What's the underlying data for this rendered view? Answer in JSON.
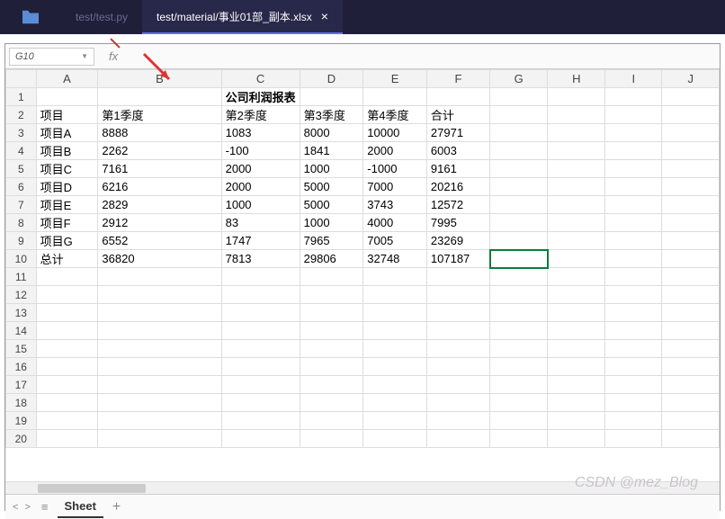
{
  "tabs": [
    {
      "label": "test/test.py",
      "active": false
    },
    {
      "label": "test/material/事业01部_副本.xlsx",
      "active": true
    }
  ],
  "namebox": "G10",
  "fx_label": "fx",
  "columns": [
    "A",
    "B",
    "C",
    "D",
    "E",
    "F",
    "G",
    "H",
    "I",
    "J"
  ],
  "wide_col": "B",
  "title_row": 1,
  "title_col": "C",
  "title_text": "公司利润报表",
  "header_row": 2,
  "headers": {
    "A": "项目",
    "B": "第1季度",
    "C": "第2季度",
    "D": "第3季度",
    "E": "第4季度",
    "F": "合计"
  },
  "data_rows": [
    {
      "row": 3,
      "cells": {
        "A": "项目A",
        "B": "8888",
        "C": "1083",
        "D": "8000",
        "E": "10000",
        "F": "27971"
      }
    },
    {
      "row": 4,
      "cells": {
        "A": "项目B",
        "B": "2262",
        "C": "-100",
        "D": "1841",
        "E": "2000",
        "F": "6003"
      }
    },
    {
      "row": 5,
      "cells": {
        "A": "项目C",
        "B": "7161",
        "C": "2000",
        "D": "1000",
        "E": "-1000",
        "F": "9161"
      }
    },
    {
      "row": 6,
      "cells": {
        "A": "项目D",
        "B": "6216",
        "C": "2000",
        "D": "5000",
        "E": "7000",
        "F": "20216"
      }
    },
    {
      "row": 7,
      "cells": {
        "A": "项目E",
        "B": "2829",
        "C": "1000",
        "D": "5000",
        "E": "3743",
        "F": "12572"
      }
    },
    {
      "row": 8,
      "cells": {
        "A": "项目F",
        "B": "2912",
        "C": "83",
        "D": "1000",
        "E": "4000",
        "F": "7995"
      }
    },
    {
      "row": 9,
      "cells": {
        "A": "项目G",
        "B": "6552",
        "C": "1747",
        "D": "7965",
        "E": "7005",
        "F": "23269"
      }
    },
    {
      "row": 10,
      "cells": {
        "A": "总计",
        "B": "36820",
        "C": "7813",
        "D": "29806",
        "E": "32748",
        "F": "107187"
      }
    }
  ],
  "visible_rows": 20,
  "selected_cell": {
    "row": 10,
    "col": "G"
  },
  "sheet_name": "Sheet",
  "watermark": "CSDN @mez_Blog"
}
